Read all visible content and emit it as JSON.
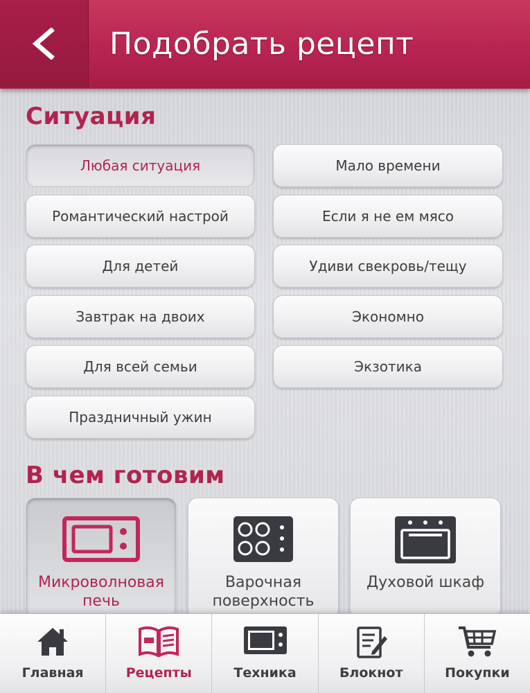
{
  "header": {
    "title": "Подобрать рецепт",
    "back_icon": "chevron-left-icon"
  },
  "situation": {
    "title": "Ситуация",
    "left": [
      "Любая ситуация",
      "Романтический настрой",
      "Для детей",
      "Завтрак на двоих",
      "Для всей семьи",
      "Праздничный ужин"
    ],
    "right": [
      "Мало времени",
      "Если я не ем мясо",
      "Удиви свекровь/тещу",
      "Экономно",
      "Экзотика"
    ],
    "selected": "Любая ситуация"
  },
  "cooking": {
    "title": "В чем готовим",
    "items": [
      {
        "label": "Микроволновая печь",
        "icon": "microwave-icon",
        "selected": true
      },
      {
        "label": "Варочная поверхность",
        "icon": "cooktop-icon",
        "selected": false
      },
      {
        "label": "Духовой шкаф",
        "icon": "oven-icon",
        "selected": false
      }
    ]
  },
  "tabs": [
    {
      "label": "Главная",
      "icon": "home-icon"
    },
    {
      "label": "Рецепты",
      "icon": "book-icon",
      "active": true
    },
    {
      "label": "Техника",
      "icon": "microwave-icon"
    },
    {
      "label": "Блокнот",
      "icon": "notepad-icon"
    },
    {
      "label": "Покупки",
      "icon": "cart-icon"
    }
  ],
  "colors": {
    "accent": "#b0244f",
    "header": "#b82550",
    "icon_dark": "#3a3b40"
  }
}
